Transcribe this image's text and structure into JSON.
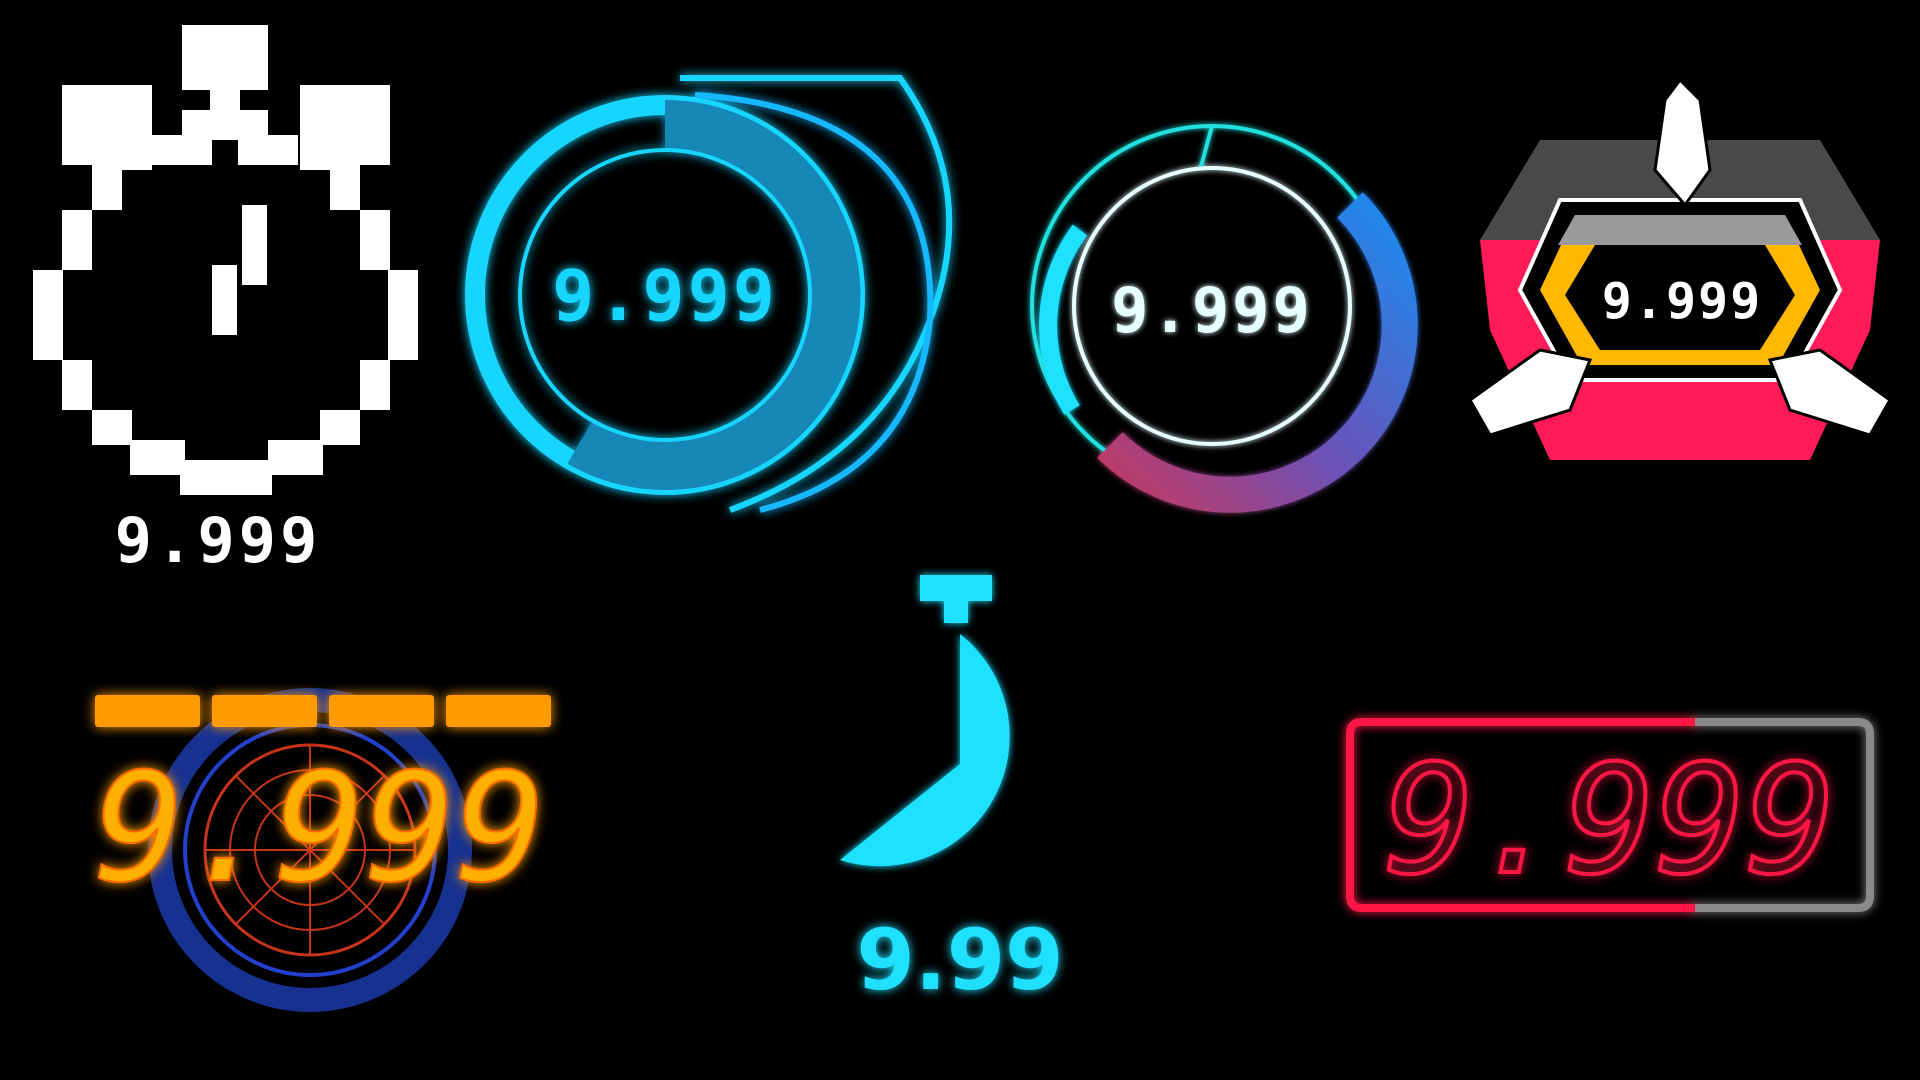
{
  "timers": {
    "pixel": {
      "value": "9.999",
      "color": "#ffffff"
    },
    "blue_ring": {
      "value": "9.999",
      "color": "#15d6ff",
      "progress": 0.7
    },
    "gradient_ring": {
      "value": "9.999",
      "color": "#e6ffff",
      "accent_start": "#1b8cf0",
      "accent_end": "#c43a62"
    },
    "hex_badge": {
      "value": "9.999",
      "colors": {
        "top": "#4a4a4a",
        "middle": "#ff1a58",
        "inner": "#ffb700",
        "spikes": "#ffffff"
      }
    },
    "orange_lcd": {
      "value": "9.999",
      "color": "#ff9a00",
      "bar_segments": 4
    },
    "pie_stopwatch": {
      "value": "9.99",
      "color": "#1fe1ff",
      "progress": 0.62
    },
    "red_lcd": {
      "value": "9.999",
      "color": "#ff1744",
      "fill_fraction": 0.68
    }
  }
}
